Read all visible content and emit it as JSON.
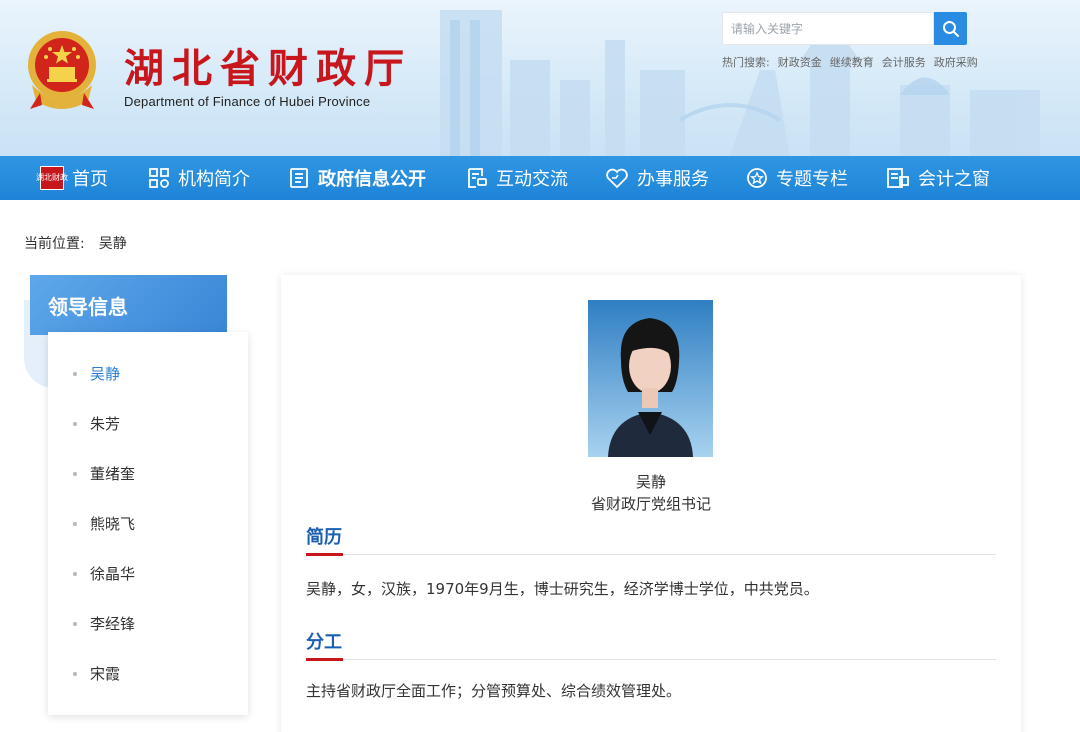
{
  "header": {
    "title": "湖北省财政厅",
    "subtitle": "Department of Finance of Hubei Province",
    "search_placeholder": "请输入关键字",
    "hot_label": "热门搜索:",
    "hot_items": [
      "财政资金",
      "继续教育",
      "会计服务",
      "政府采购"
    ]
  },
  "nav": {
    "home_badge": "湖北财政",
    "items": [
      {
        "label": "首页",
        "icon": "home-badge-icon"
      },
      {
        "label": "机构简介",
        "icon": "grid-icon"
      },
      {
        "label": "政府信息公开",
        "icon": "document-icon"
      },
      {
        "label": "互动交流",
        "icon": "chat-form-icon"
      },
      {
        "label": "办事服务",
        "icon": "heart-icon"
      },
      {
        "label": "专题专栏",
        "icon": "star-circle-icon"
      },
      {
        "label": "会计之窗",
        "icon": "ledger-icon"
      }
    ]
  },
  "breadcrumb": {
    "label": "当前位置:",
    "current": "吴静"
  },
  "sidebar": {
    "title": "领导信息",
    "items": [
      "吴静",
      "朱芳",
      "董绪奎",
      "熊晓飞",
      "徐晶华",
      "李经锋",
      "宋霞"
    ],
    "active_index": 0
  },
  "profile": {
    "name": "吴静",
    "position": "省财政厅党组书记",
    "resume_title": "简历",
    "resume_text": "吴静，女，汉族，1970年9月生，博士研究生，经济学博士学位，中共党员。",
    "duty_title": "分工",
    "duty_text": "主持省财政厅全面工作；分管预算处、综合绩效管理处。"
  },
  "colors": {
    "nav_blue": "#2a8be2",
    "title_red": "#c8161d",
    "section_blue": "#1b5fb0",
    "active_link": "#2a7fd4"
  }
}
